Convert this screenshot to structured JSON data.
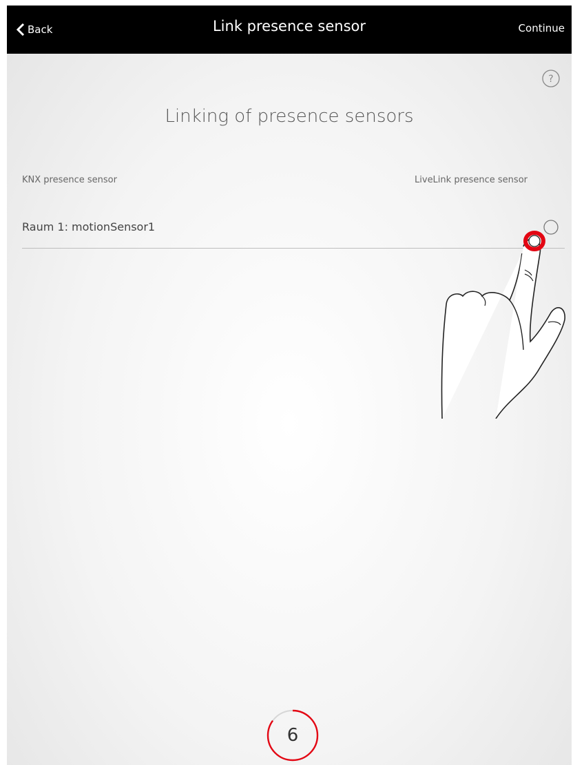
{
  "navbar": {
    "back_label": "Back",
    "title": "Link presence sensor",
    "continue_label": "Continue"
  },
  "heading": "Linking of presence sensors",
  "columns": {
    "left": "KNX presence sensor",
    "right": "LiveLink presence sensor"
  },
  "rows": [
    {
      "label": "Raum 1: motionSensor1",
      "selected": false
    }
  ],
  "icons": {
    "back": "chevron-left-icon",
    "help": "question-circle-icon",
    "radio": "radio-circle-icon",
    "hand": "tapping-hand-icon"
  },
  "step_counter": {
    "value": "6",
    "progress": 0.85
  },
  "colors": {
    "accent": "#e30613",
    "navbar": "#000000"
  }
}
